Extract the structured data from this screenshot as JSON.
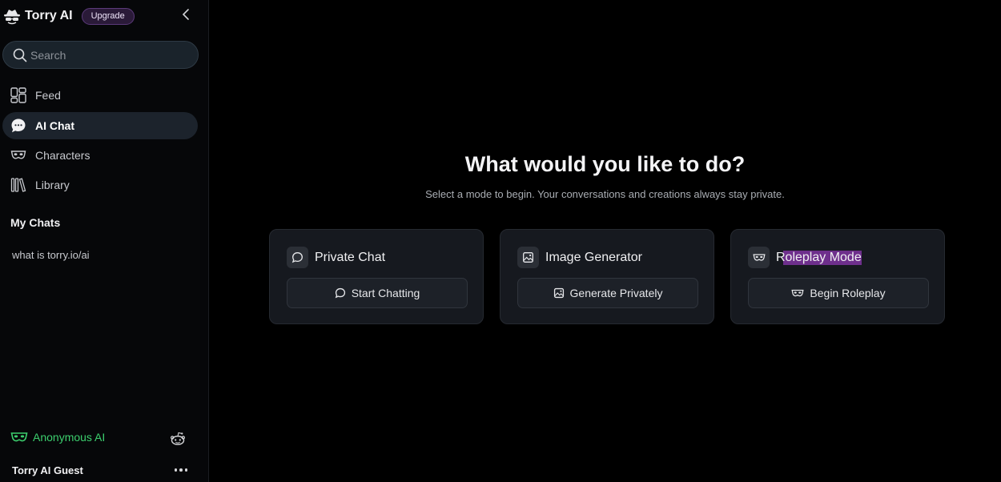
{
  "sidebar": {
    "brand": "Torry AI",
    "upgrade_label": "Upgrade",
    "search_placeholder": "Search",
    "nav": [
      {
        "label": "Feed",
        "icon": "feed-icon"
      },
      {
        "label": "AI Chat",
        "icon": "chat-bubble-icon",
        "active": true
      },
      {
        "label": "Characters",
        "icon": "mask-icon"
      },
      {
        "label": "Library",
        "icon": "library-icon"
      }
    ],
    "my_chats_title": "My Chats",
    "chats": [
      "what is torry.io/ai"
    ],
    "anonymous_label": "Anonymous AI",
    "user_name": "Torry AI Guest"
  },
  "main": {
    "title": "What would you like to do?",
    "subtitle": "Select a mode to begin. Your conversations and creations always stay private.",
    "cards": [
      {
        "title": "Private Chat",
        "button": "Start Chatting",
        "icon": "chat-icon"
      },
      {
        "title": "Image Generator",
        "button": "Generate Privately",
        "icon": "image-icon"
      },
      {
        "title": "Roleplay Mode",
        "button": "Begin Roleplay",
        "icon": "mask-icon"
      }
    ]
  },
  "colors": {
    "background": "#000000",
    "sidebar": "#060709",
    "card": "#16191f",
    "accent_green": "#3ccf6e",
    "upgrade_purple": "#5b3a7a",
    "highlight": "#6e2f8c"
  }
}
